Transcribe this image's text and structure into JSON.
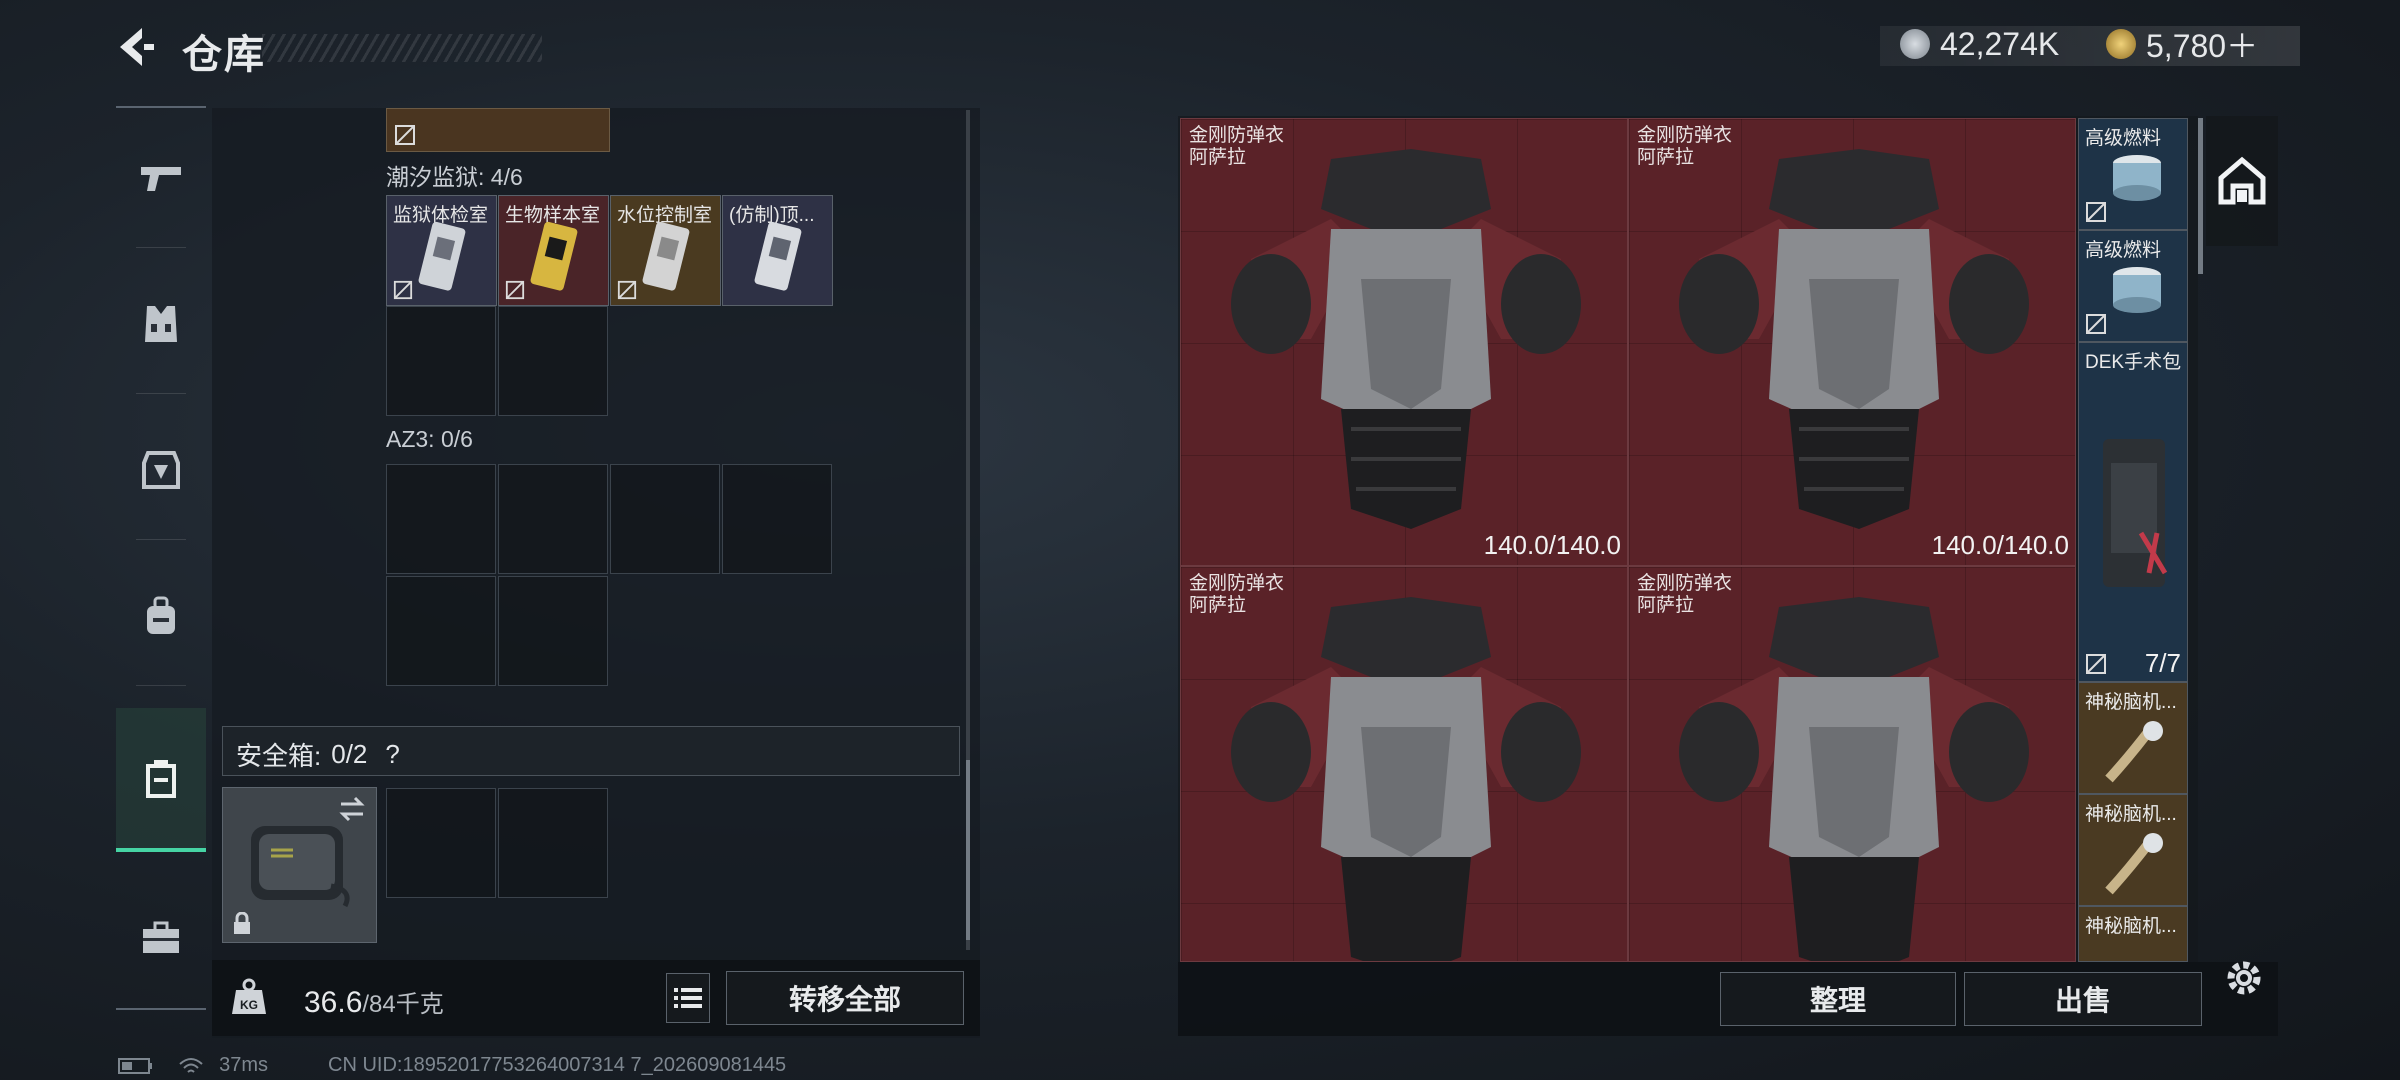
{
  "header": {
    "title": "仓库",
    "currency": [
      {
        "icon": "silver-coin-icon",
        "value": "42,274K"
      },
      {
        "icon": "gold-coin-icon",
        "value": "5,780＋"
      }
    ]
  },
  "sidebar": {
    "items": [
      {
        "name": "sidebar-item-weapons",
        "icon": "pistol-icon"
      },
      {
        "name": "sidebar-item-vest",
        "icon": "vest-icon"
      },
      {
        "name": "sidebar-item-armor",
        "icon": "armor-icon"
      },
      {
        "name": "sidebar-item-backpack",
        "icon": "backpack-icon"
      },
      {
        "name": "sidebar-item-case",
        "icon": "case-icon",
        "active": true
      },
      {
        "name": "sidebar-item-toolbox",
        "icon": "toolbox-icon"
      }
    ]
  },
  "left": {
    "section1": {
      "label": "潮汐监狱: 4/6",
      "items": [
        "监狱体检室",
        "生物样本室",
        "水位控制室",
        "(仿制)顶..."
      ]
    },
    "section2": {
      "label": "AZ3: 0/6"
    },
    "safe": {
      "label": "安全箱:",
      "count": "0/2",
      "help": "?"
    },
    "weight": {
      "value": "36.6",
      "max": "/84千克"
    },
    "transfer_all": "转移全部"
  },
  "right": {
    "armors": [
      {
        "name": "金刚防弹衣",
        "sub": "阿萨拉",
        "durability": "140.0/140.0"
      },
      {
        "name": "金刚防弹衣",
        "sub": "阿萨拉",
        "durability": "140.0/140.0"
      },
      {
        "name": "金刚防弹衣",
        "sub": "阿萨拉",
        "durability": ""
      },
      {
        "name": "金刚防弹衣",
        "sub": "阿萨拉",
        "durability": ""
      }
    ],
    "side_items": [
      {
        "name": "高级燃料"
      },
      {
        "name": "高级燃料"
      },
      {
        "name": "DEK手术包",
        "count": "7/7"
      },
      {
        "name": "神秘脑机..."
      },
      {
        "name": "神秘脑机..."
      },
      {
        "name": "神秘脑机..."
      }
    ],
    "sort_label": "整理",
    "sell_label": "出售"
  },
  "status": {
    "ping": "37ms",
    "uid": "CN UID:18952017753264007314 7_202609081445"
  },
  "colors": {
    "accent": "#46d4a4",
    "armor_bg": "#5a2228",
    "gold": "#c4a24a"
  }
}
